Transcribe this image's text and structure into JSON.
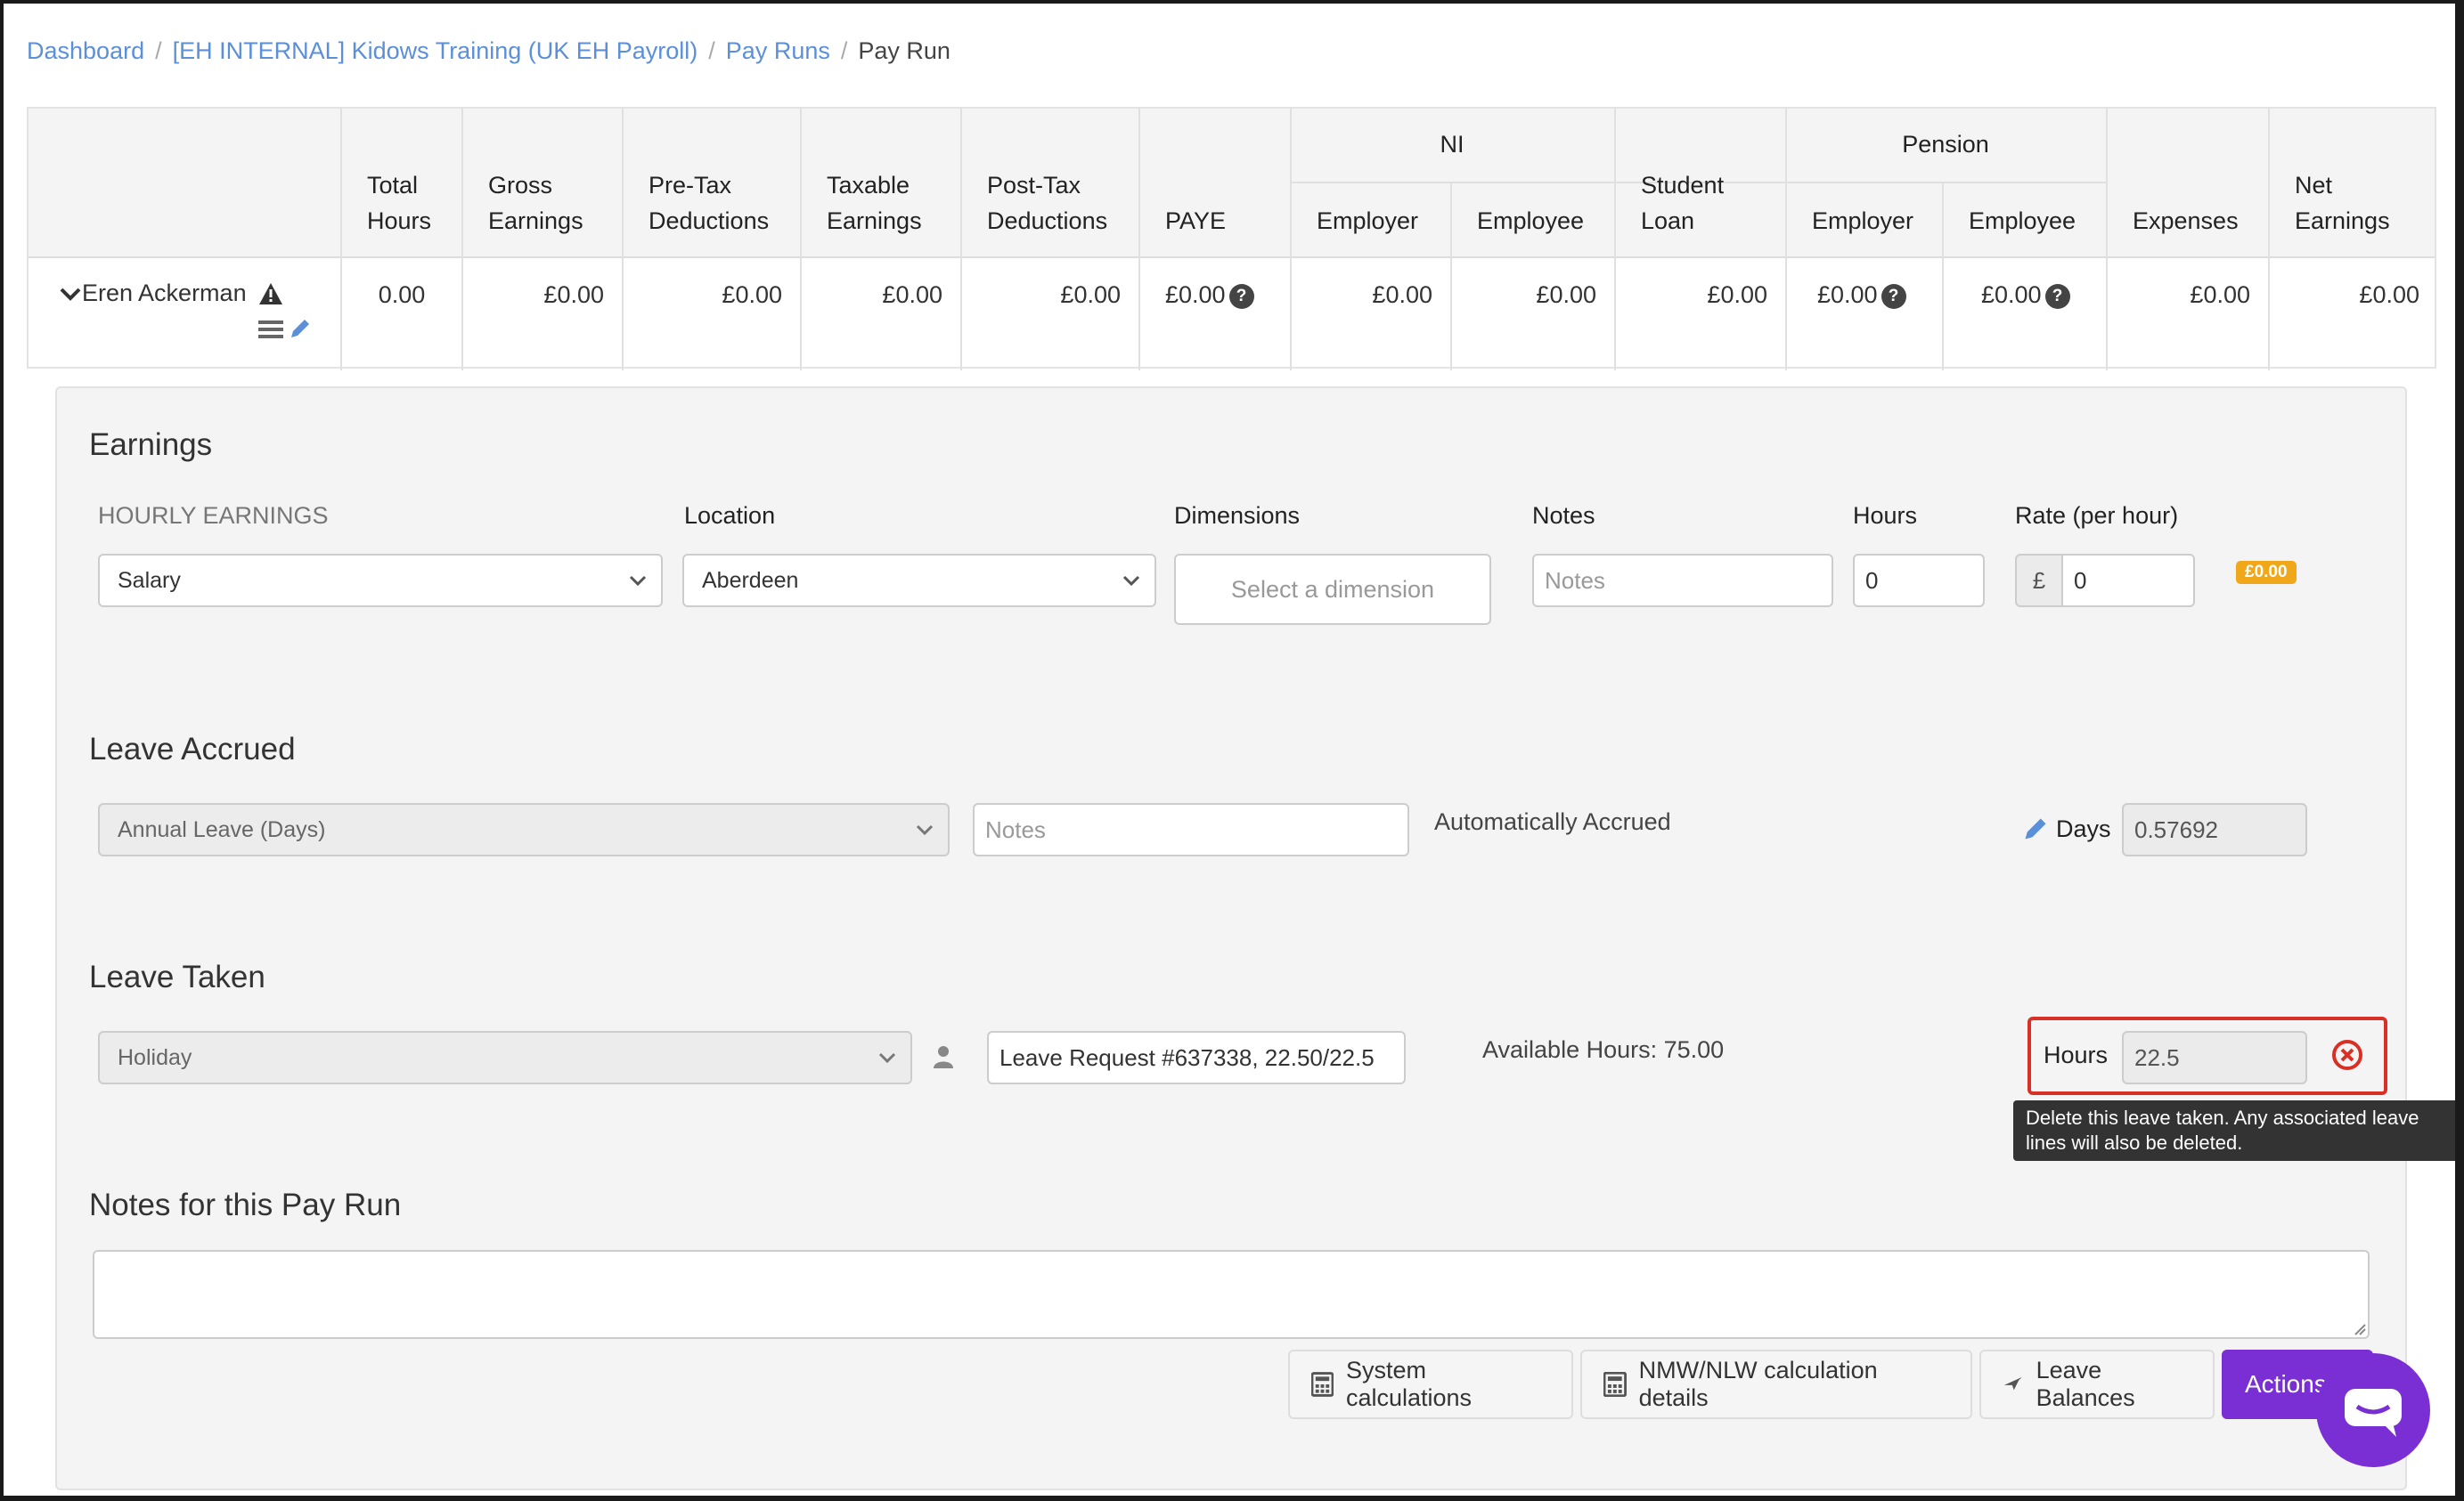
{
  "breadcrumb": {
    "items": [
      "Dashboard",
      "[EH INTERNAL] Kidows Training (UK EH Payroll)",
      "Pay Runs"
    ],
    "separator": "/",
    "current": "Pay Run"
  },
  "table": {
    "group_headers": {
      "ni": "NI",
      "pension": "Pension"
    },
    "headers": {
      "total_hours": [
        "Total",
        "Hours"
      ],
      "gross": [
        "Gross",
        "Earnings"
      ],
      "pretax": [
        "Pre-Tax",
        "Deductions"
      ],
      "taxable": [
        "Taxable",
        "Earnings"
      ],
      "posttax": [
        "Post-Tax",
        "Deductions"
      ],
      "paye": "PAYE",
      "ni_employer": "Employer",
      "ni_employee": "Employee",
      "student": [
        "Student",
        "Loan"
      ],
      "pen_employer": "Employer",
      "pen_employee": "Employee",
      "expenses": "Expenses",
      "net": [
        "Net",
        "Earnings"
      ]
    },
    "row": {
      "employee": "Eren Ackerman",
      "total_hours": "0.00",
      "gross": "£0.00",
      "pretax": "£0.00",
      "taxable": "£0.00",
      "posttax": "£0.00",
      "paye": "£0.00",
      "ni_employer": "£0.00",
      "ni_employee": "£0.00",
      "student": "£0.00",
      "pen_employer": "£0.00",
      "pen_employee": "£0.00",
      "expenses": "£0.00",
      "net": "£0.00"
    },
    "help_glyph": "?"
  },
  "earnings": {
    "title": "Earnings",
    "labels": {
      "type": "HOURLY EARNINGS",
      "location": "Location",
      "dimensions": "Dimensions",
      "notes": "Notes",
      "hours": "Hours",
      "rate": "Rate (per hour)"
    },
    "type_value": "Salary",
    "location_value": "Aberdeen",
    "dimension_placeholder": "Select a dimension",
    "notes_placeholder": "Notes",
    "hours_value": "0",
    "currency_symbol": "£",
    "rate_value": "0",
    "total_badge": "£0.00"
  },
  "leave_accrued": {
    "title": "Leave Accrued",
    "type_value": "Annual Leave (Days)",
    "notes_placeholder": "Notes",
    "status": "Automatically Accrued",
    "days_label": "Days",
    "days_value": "0.57692"
  },
  "leave_taken": {
    "title": "Leave Taken",
    "type_value": "Holiday",
    "notes_value": "Leave Request #637338, 22.50/22.5",
    "available": "Available Hours: 75.00",
    "hours_label": "Hours",
    "hours_value": "22.5",
    "tooltip_line1": "Delete this leave taken. Any associated leave",
    "tooltip_line2": "lines will also be deleted."
  },
  "notes_section": {
    "title": "Notes for this Pay Run"
  },
  "buttons": {
    "system_calc": "System calculations",
    "nmw": "NMW/NLW calculation details",
    "leave_balances": "Leave Balances",
    "actions": "Actions"
  },
  "colors": {
    "link": "#5b8fd8",
    "primary": "#7a2fd4",
    "badge": "#f0a81a",
    "highlight": "#d93025"
  }
}
